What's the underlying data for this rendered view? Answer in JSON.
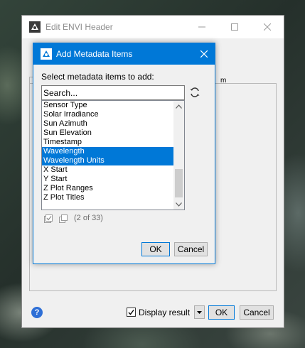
{
  "main_window": {
    "title": "Edit ENVI Header",
    "tab_fragment": "m",
    "display_result_label": "Display result",
    "display_result_checked": true,
    "ok_label": "OK",
    "cancel_label": "Cancel",
    "help_glyph": "?"
  },
  "dialog": {
    "title": "Add Metadata Items",
    "prompt": "Select metadata items to add:",
    "search_placeholder": "Search...",
    "items": [
      {
        "label": "Sensor Type",
        "selected": false
      },
      {
        "label": "Solar Irradiance",
        "selected": false
      },
      {
        "label": "Sun Azimuth",
        "selected": false
      },
      {
        "label": "Sun Elevation",
        "selected": false
      },
      {
        "label": "Timestamp",
        "selected": false
      },
      {
        "label": "Wavelength",
        "selected": true
      },
      {
        "label": "Wavelength Units",
        "selected": true
      },
      {
        "label": "X Start",
        "selected": false
      },
      {
        "label": "Y Start",
        "selected": false
      },
      {
        "label": "Z Plot Ranges",
        "selected": false
      },
      {
        "label": "Z Plot Titles",
        "selected": false
      }
    ],
    "count_text": "(2 of 33)",
    "ok_label": "OK",
    "cancel_label": "Cancel"
  },
  "colors": {
    "accent": "#0078d7",
    "selection": "#0078d7",
    "window_bg": "#f0f0f0"
  },
  "icons": [
    "envi-app-icon",
    "minimize-icon",
    "maximize-icon",
    "close-icon",
    "refresh-icon",
    "chevron-up-icon",
    "chevron-down-icon",
    "select-all-icon",
    "deselect-all-icon",
    "help-icon",
    "dropdown-arrow-icon",
    "checkmark-icon"
  ]
}
